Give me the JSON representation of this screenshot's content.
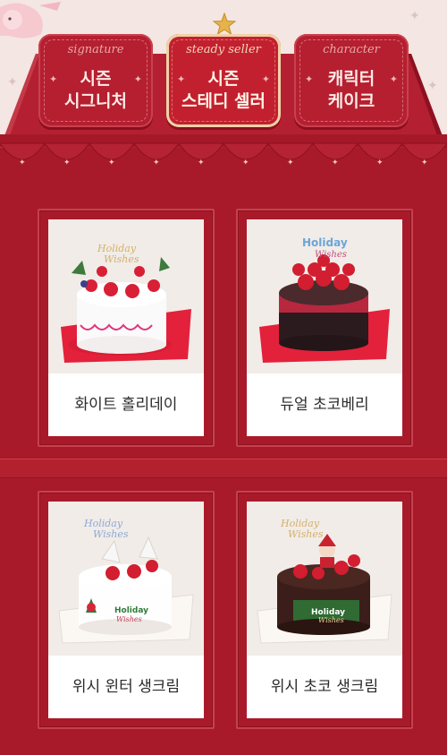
{
  "tabs": [
    {
      "script": "signature",
      "name": "시즌\n시그니처",
      "active": false
    },
    {
      "script": "steady seller",
      "name": "시즌\n스테디 셀러",
      "active": true
    },
    {
      "script": "character",
      "name": "캐릭터\n케이크",
      "active": false
    }
  ],
  "products": [
    {
      "name": "화이트 홀리데이",
      "topper": "Holiday Wishes"
    },
    {
      "name": "듀얼 초코베리",
      "topper": "Holiday Wishes"
    },
    {
      "name": "위시 윈터 생크림",
      "topper": "Holiday Wishes"
    },
    {
      "name": "위시 초코 생크림",
      "topper": "Holiday Wishes"
    }
  ],
  "colors": {
    "background": "#a81a2a",
    "tab": "#b51f30",
    "accent": "#f0d2a8"
  }
}
